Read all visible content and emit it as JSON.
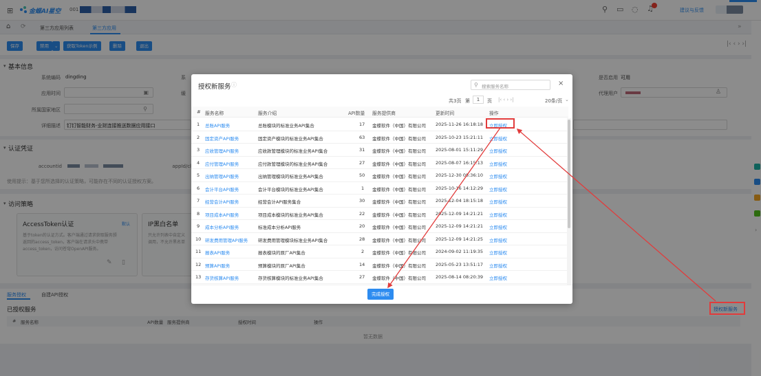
{
  "app": {
    "brand": "金蝶AI星空",
    "account_prefix": "001",
    "feedback_label": "建议与反馈"
  },
  "tabs": [
    {
      "label": "第三方应用列表"
    },
    {
      "label": "第三方应用"
    }
  ],
  "toolbar": {
    "save": "保存",
    "disable": "禁用",
    "get_token": "获取Token示例",
    "delete": "删除",
    "exit": "退出"
  },
  "basic_info": {
    "title": "基本信息",
    "system_code_label": "系统编码",
    "system_code_value": "dingding",
    "system_name_label": "系",
    "app_time_label": "应用时间",
    "note_label": "缓",
    "country_label": "所属国家地区",
    "detail_label": "详细描述",
    "detail_value": "钉钉智能财务-业财连接推送数据应用接口",
    "enabled_label": "是否启用",
    "enabled_value": "可用",
    "proxy_user_label": "代理用户"
  },
  "auth": {
    "title": "认证凭证",
    "accountid_label": "accountid",
    "appid_label": "appId/cli",
    "hint": "使用提示：基于您所选择的认证策略，可能存在不同的认证授权方案。"
  },
  "policy": {
    "title": "访问策略",
    "token_card_title": "AccessToken认证",
    "token_card_tag": "默认",
    "token_card_desc1": "基于token的认证方式。客户端通过请求获取服务颁",
    "token_card_desc2": "返回的access_token，客户端在请求头中携带",
    "token_card_desc3": "access_token，访问苍穹OpenAPI服务。",
    "ip_card_title": "IP黑白名单",
    "ip_card_desc1": "只允许列表中自定义",
    "ip_card_desc2": "调用，不允许黑名单"
  },
  "service_tabs": {
    "authorized": "服务授权",
    "custom": "自建API授权"
  },
  "authorized_services": {
    "title": "已授权服务",
    "authorize_new": "授权新服务",
    "col_idx": "#",
    "col_name": "服务名称",
    "col_count": "API数量",
    "col_provider": "服务提供商",
    "col_time": "授权时间",
    "col_op": "操作",
    "empty": "暂无数据"
  },
  "modal": {
    "title": "授权新服务",
    "search_placeholder": "搜索服务名称",
    "close": "×",
    "pager": {
      "total": "共3页",
      "page_prefix": "第",
      "page": "1",
      "page_suffix": "页",
      "page_size": "20条/页"
    },
    "columns": {
      "idx": "#",
      "name": "服务名称",
      "desc": "服务介绍",
      "count": "API数量",
      "provider": "服务提供商",
      "time": "更新时间",
      "op": "操作"
    },
    "op_label": "立即授权",
    "rows": [
      {
        "idx": "1",
        "name": "总账API服务",
        "desc": "总账模块的标准业务API集合",
        "count": "17",
        "provider": "金蝶软件（中国）有限公司",
        "time": "2025-11-26 16:18:18"
      },
      {
        "idx": "2",
        "name": "固定资产API服务",
        "desc": "固定资产模块的标准业务API集合",
        "count": "63",
        "provider": "金蝶软件（中国）有限公司",
        "time": "2025-10-23 15:21:11"
      },
      {
        "idx": "3",
        "name": "应收管理API服务",
        "desc": "应收款管理模块的标准业务API集合",
        "count": "31",
        "provider": "金蝶软件（中国）有限公司",
        "time": "2025-08-01 15:11:29"
      },
      {
        "idx": "4",
        "name": "应付管理API服务",
        "desc": "应付款管理模块的标准业务API集合",
        "count": "27",
        "provider": "金蝶软件（中国）有限公司",
        "time": "2025-08-07 16:15:13"
      },
      {
        "idx": "5",
        "name": "出纳管理API服务",
        "desc": "出纳管理模块的标准业务API集合",
        "count": "50",
        "provider": "金蝶软件（中国）有限公司",
        "time": "2025-12-30 08:36:10"
      },
      {
        "idx": "6",
        "name": "会计平台API服务",
        "desc": "会计平台模块的标准业务API集合",
        "count": "1",
        "provider": "金蝶软件（中国）有限公司",
        "time": "2025-10-16 14:12:29"
      },
      {
        "idx": "7",
        "name": "经营会计API服务",
        "desc": "经营会计API服务集合",
        "count": "30",
        "provider": "金蝶软件（中国）有限公司",
        "time": "2025-12-04 18:15:18"
      },
      {
        "idx": "8",
        "name": "项目成本API服务",
        "desc": "项目成本模块的标准业务API集合",
        "count": "22",
        "provider": "金蝶软件（中国）有限公司",
        "time": "2025-12-09 14:21:21"
      },
      {
        "idx": "9",
        "name": "成本分析API服务",
        "desc": "标准成本分析API服务",
        "count": "20",
        "provider": "金蝶软件（中国）有限公司",
        "time": "2025-12-09 14:21:21"
      },
      {
        "idx": "10",
        "name": "研发费用管理API服务",
        "desc": "研发费用管理模块标准业务API集合",
        "count": "28",
        "provider": "金蝶软件（中国）有限公司",
        "time": "2025-12-09 14:21:25"
      },
      {
        "idx": "11",
        "name": "报表API服务",
        "desc": "报表模块的原厂API集合",
        "count": "2",
        "provider": "金蝶软件（中国）有限公司",
        "time": "2024-09-02 11:19:35"
      },
      {
        "idx": "12",
        "name": "预算API服务",
        "desc": "预算模块的原厂API集合",
        "count": "14",
        "provider": "金蝶软件（中国）有限公司",
        "time": "2025-05-23 13:51:17"
      },
      {
        "idx": "13",
        "name": "存货核算API服务",
        "desc": "存货核算模块的标准业务API集合",
        "count": "27",
        "provider": "金蝶软件（中国）有限公司",
        "time": "2025-08-14 08:20:39"
      }
    ],
    "finish_button": "完成授权"
  },
  "colors": {
    "primary": "#2d8cf0",
    "annotation": "#e23b3b"
  }
}
